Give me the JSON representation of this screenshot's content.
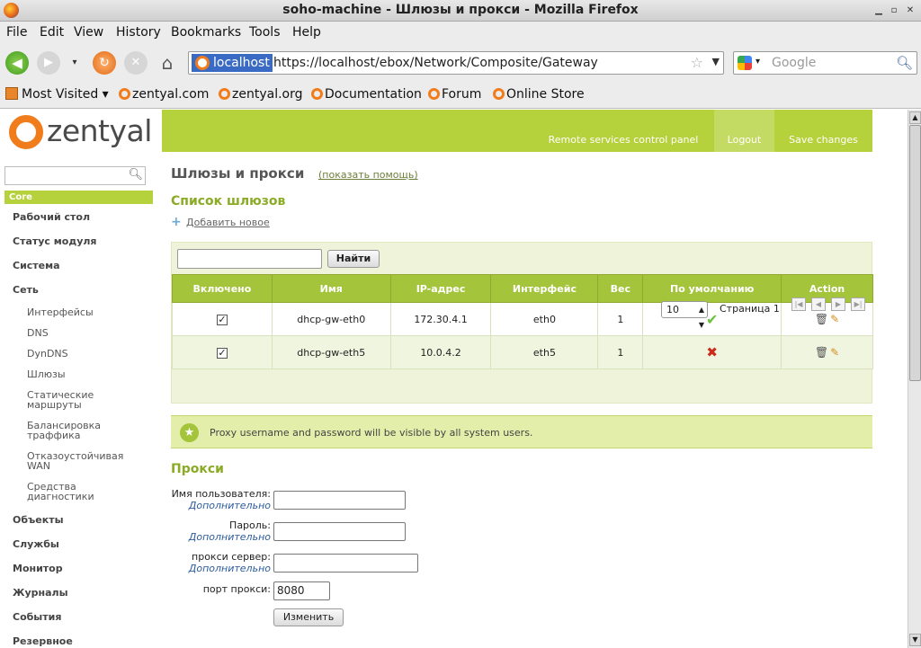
{
  "window": {
    "title": "soho-machine - Шлюзы и прокси - Mozilla Firefox"
  },
  "menubar": [
    "File",
    "Edit",
    "View",
    "History",
    "Bookmarks",
    "Tools",
    "Help"
  ],
  "urlbar": {
    "site": "localhost",
    "url": "https://localhost/ebox/Network/Composite/Gateway"
  },
  "search": {
    "placeholder": "Google"
  },
  "bookmarks": [
    "Most Visited",
    "zentyal.com",
    "zentyal.org",
    "Documentation",
    "Forum",
    "Online Store"
  ],
  "header": {
    "logo_text": "zentyal",
    "tabs": [
      "Remote services control panel",
      "Logout",
      "Save changes"
    ]
  },
  "sidebar": {
    "section": "Core",
    "items": [
      "Рабочий стол",
      "Статус модуля",
      "Система",
      "Сеть"
    ],
    "network_sub": [
      "Интерфейсы",
      "DNS",
      "DynDNS",
      "Шлюзы",
      "Статические маршруты",
      "Балансировка траффика",
      "Отказоустойчивая WAN",
      "Средства диагностики"
    ],
    "more_items": [
      "Объекты",
      "Службы",
      "Монитор",
      "Журналы",
      "События",
      "Резервное"
    ]
  },
  "page": {
    "title": "Шлюзы и прокси",
    "help_link": "(показать помощь)",
    "gateways_title": "Список шлюзов",
    "add_new": "Добавить новое",
    "filter_button": "Найти",
    "table": {
      "headers": [
        "Включено",
        "Имя",
        "IP-адрес",
        "Интерфейс",
        "Вес",
        "По умолчанию",
        "Action"
      ],
      "rows": [
        {
          "enabled": "✓",
          "name": "dhcp-gw-eth0",
          "ip": "172.30.4.1",
          "iface": "eth0",
          "weight": "1",
          "default": true
        },
        {
          "enabled": "✓",
          "name": "dhcp-gw-eth5",
          "ip": "10.0.4.2",
          "iface": "eth5",
          "weight": "1",
          "default": false
        }
      ]
    },
    "pager": {
      "page_size": "10",
      "page_label": "Страница 1"
    },
    "note": "Proxy username and password will be visible by all system users.",
    "proxy": {
      "title": "Прокси",
      "user_label": "Имя пользователя:",
      "password_label": "Пароль:",
      "server_label": "прокси сервер:",
      "optional": "Дополнительно",
      "port_label": "порт прокси:",
      "port_value": "8080",
      "change_button": "Изменить"
    }
  }
}
